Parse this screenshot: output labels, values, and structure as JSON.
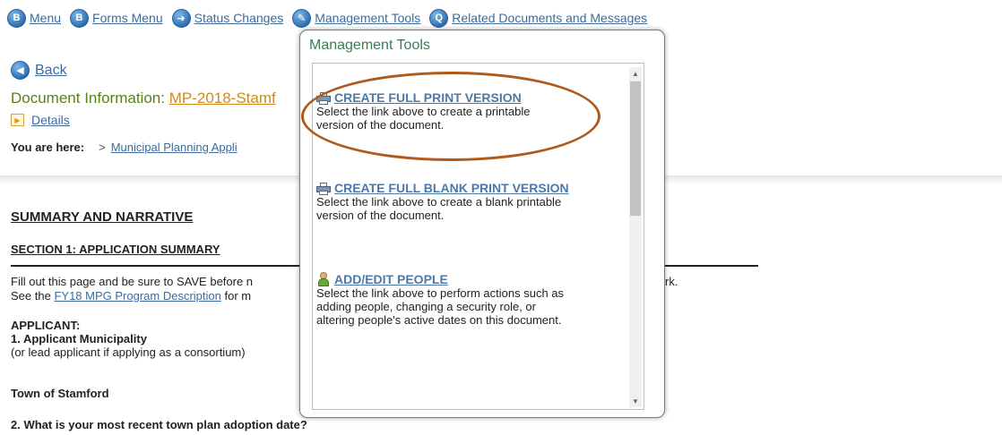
{
  "nav": {
    "menu": "Menu",
    "forms_menu": "Forms Menu",
    "status_changes": "Status Changes",
    "management_tools": "Management Tools",
    "related_docs": "Related Documents and Messages"
  },
  "back_label": "Back",
  "doc_info": {
    "label": "Document Information:",
    "doc_id": "MP-2018-Stamf"
  },
  "details_label": "Details",
  "breadcrumb": {
    "label": "You are here:",
    "sep": ">",
    "crumb": "Municipal Planning Appli"
  },
  "content": {
    "summary_heading": "SUMMARY AND NARRATIVE",
    "section1_heading": "SECTION 1: APPLICATION SUMMARY",
    "line1_pre": "Fill out this page and be sure to SAVE before n",
    "line1_tail": "rk.",
    "line2_pre": "See the",
    "line2_link": "FY18 MPG Program Description",
    "line2_post": "for m",
    "applicant_heading": "APPLICANT:",
    "q1": "1. Applicant Municipality",
    "q1_note": "(or lead applicant if applying as a consortium)",
    "town": "Town of Stamford",
    "q2": "2. What is your most recent town plan adoption date?"
  },
  "modal": {
    "title": "Management Tools",
    "items": [
      {
        "link": "CREATE FULL PRINT VERSION",
        "desc1": "Select the link above to create a printable",
        "desc2": "version of the document."
      },
      {
        "link": "CREATE FULL BLANK PRINT VERSION",
        "desc1": "Select the link above to create a blank printable",
        "desc2": "version of the document."
      },
      {
        "link": "ADD/EDIT PEOPLE",
        "desc1": "Select the link above to perform actions such as",
        "desc2": "adding people, changing a security role, or",
        "desc3": "altering people's active dates on this document."
      }
    ]
  },
  "colors": {
    "link": "#3d6a9b",
    "doc_green": "#5a7f1a",
    "doc_orange": "#d08a1d",
    "highlight": "#b05a1c"
  }
}
